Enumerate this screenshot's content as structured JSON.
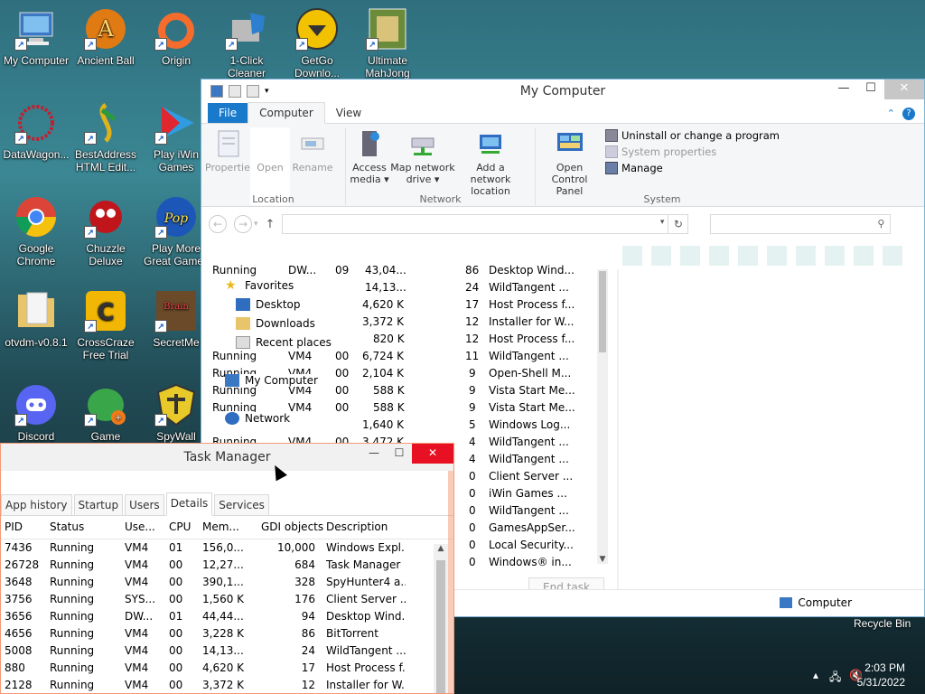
{
  "desktop": {
    "icons": [
      {
        "label": "My Computer"
      },
      {
        "label": "Ancient Ball"
      },
      {
        "label": "Origin"
      },
      {
        "label": "1-Click Cleaner"
      },
      {
        "label": "GetGo Downlo..."
      },
      {
        "label": "Ultimate MahJong"
      },
      {
        "label": "DataWagon..."
      },
      {
        "label": "BestAddress HTML Edit..."
      },
      {
        "label": "Play iWin Games"
      },
      {
        "label": "Google Chrome"
      },
      {
        "label": "Chuzzle Deluxe"
      },
      {
        "label": "Play More Great Games"
      },
      {
        "label": "otvdm-v0.8.1"
      },
      {
        "label": "CrossCraze Free Trial"
      },
      {
        "label": "SecretMe"
      },
      {
        "label": "Discord"
      },
      {
        "label": "Game"
      },
      {
        "label": "SpyWall"
      }
    ],
    "recycle_bin": "Recycle Bin"
  },
  "explorer": {
    "title": "My Computer",
    "tabs": [
      "File",
      "Computer",
      "View"
    ],
    "ribbon": {
      "location": {
        "label": "Location",
        "buttons": [
          "Properties",
          "Open",
          "Rename"
        ]
      },
      "network": {
        "label": "Network",
        "buttons": [
          "Access media ▾",
          "Map network drive ▾",
          "Add a network location"
        ]
      },
      "system": {
        "label": "System",
        "open_control_panel": "Open Control Panel",
        "items": [
          "Uninstall or change a program",
          "System properties",
          "Manage"
        ]
      }
    },
    "nav": {
      "favorites": "Favorites",
      "desktop": "Desktop",
      "downloads": "Downloads",
      "recent_places": "Recent places",
      "my_computer": "My Computer",
      "network": "Network"
    },
    "ghost_rows": [
      {
        "status": "Running",
        "user": "DW...",
        "cpu": "09",
        "mem": "43,04...",
        "gdi": "86",
        "desc": "Desktop Wind..."
      },
      {
        "status": "",
        "user": "",
        "cpu": "",
        "mem": "14,13...",
        "gdi": "24",
        "desc": "WildTangent ..."
      },
      {
        "status": "",
        "user": "",
        "cpu": "",
        "mem": "4,620 K",
        "gdi": "17",
        "desc": "Host Process f..."
      },
      {
        "status": "",
        "user": "",
        "cpu": "",
        "mem": "3,372 K",
        "gdi": "12",
        "desc": "Installer for W..."
      },
      {
        "status": "",
        "user": "",
        "cpu": "",
        "mem": "820 K",
        "gdi": "12",
        "desc": "Host Process f..."
      },
      {
        "status": "Running",
        "user": "VM4",
        "cpu": "00",
        "mem": "6,724 K",
        "gdi": "11",
        "desc": "WildTangent ..."
      },
      {
        "status": "Running",
        "user": "VM4",
        "cpu": "00",
        "mem": "2,104 K",
        "gdi": "9",
        "desc": "Open-Shell M..."
      },
      {
        "status": "Running",
        "user": "VM4",
        "cpu": "00",
        "mem": "588 K",
        "gdi": "9",
        "desc": "Vista Start Me..."
      },
      {
        "status": "Running",
        "user": "VM4",
        "cpu": "00",
        "mem": "588 K",
        "gdi": "9",
        "desc": "Vista Start Me..."
      },
      {
        "status": "",
        "user": "",
        "cpu": "",
        "mem": "1,640 K",
        "gdi": "5",
        "desc": "Windows Log..."
      },
      {
        "status": "Running",
        "user": "VM4",
        "cpu": "00",
        "mem": "3,472 K",
        "gdi": "4",
        "desc": "WildTangent ..."
      },
      {
        "status": "",
        "user": "",
        "cpu": "",
        "mem": "",
        "gdi": "4",
        "desc": "WildTangent ..."
      },
      {
        "status": "",
        "user": "",
        "cpu": "",
        "mem": "",
        "gdi": "0",
        "desc": "Client Server ..."
      },
      {
        "status": "",
        "user": "",
        "cpu": "",
        "mem": "",
        "gdi": "0",
        "desc": "iWin Games ..."
      },
      {
        "status": "",
        "user": "",
        "cpu": "",
        "mem": "",
        "gdi": "0",
        "desc": "WildTangent ..."
      },
      {
        "status": "",
        "user": "",
        "cpu": "",
        "mem": "",
        "gdi": "0",
        "desc": "GamesAppSer..."
      },
      {
        "status": "",
        "user": "",
        "cpu": "",
        "mem": "",
        "gdi": "0",
        "desc": "Local Security..."
      },
      {
        "status": "",
        "user": "",
        "cpu": "",
        "mem": "",
        "gdi": "0",
        "desc": "Windows® in..."
      }
    ],
    "end_task": "End task",
    "status_computer": "Computer"
  },
  "taskmanager": {
    "title": "Task Manager",
    "tabs": [
      "App history",
      "Startup",
      "Users",
      "Details",
      "Services"
    ],
    "columns": [
      "PID",
      "Status",
      "Use...",
      "CPU",
      "Mem...",
      "GDI objects",
      "Description"
    ],
    "rows": [
      [
        "7436",
        "Running",
        "VM4",
        "01",
        "156,0...",
        "10,000",
        "Windows Expl..."
      ],
      [
        "26728",
        "Running",
        "VM4",
        "00",
        "12,27...",
        "684",
        "Task Manager"
      ],
      [
        "3648",
        "Running",
        "VM4",
        "00",
        "390,1...",
        "328",
        "SpyHunter4 a..."
      ],
      [
        "3756",
        "Running",
        "SYS...",
        "00",
        "1,560 K",
        "176",
        "Client Server ..."
      ],
      [
        "3656",
        "Running",
        "DW...",
        "01",
        "44,44...",
        "94",
        "Desktop Wind..."
      ],
      [
        "4656",
        "Running",
        "VM4",
        "00",
        "3,228 K",
        "86",
        "BitTorrent"
      ],
      [
        "5008",
        "Running",
        "VM4",
        "00",
        "14,13...",
        "24",
        "WildTangent ..."
      ],
      [
        "880",
        "Running",
        "VM4",
        "00",
        "4,620 K",
        "17",
        "Host Process f..."
      ],
      [
        "2128",
        "Running",
        "VM4",
        "00",
        "3,372 K",
        "12",
        "Installer for W..."
      ]
    ]
  },
  "tray": {
    "time": "2:03 PM",
    "date": "5/31/2022"
  }
}
